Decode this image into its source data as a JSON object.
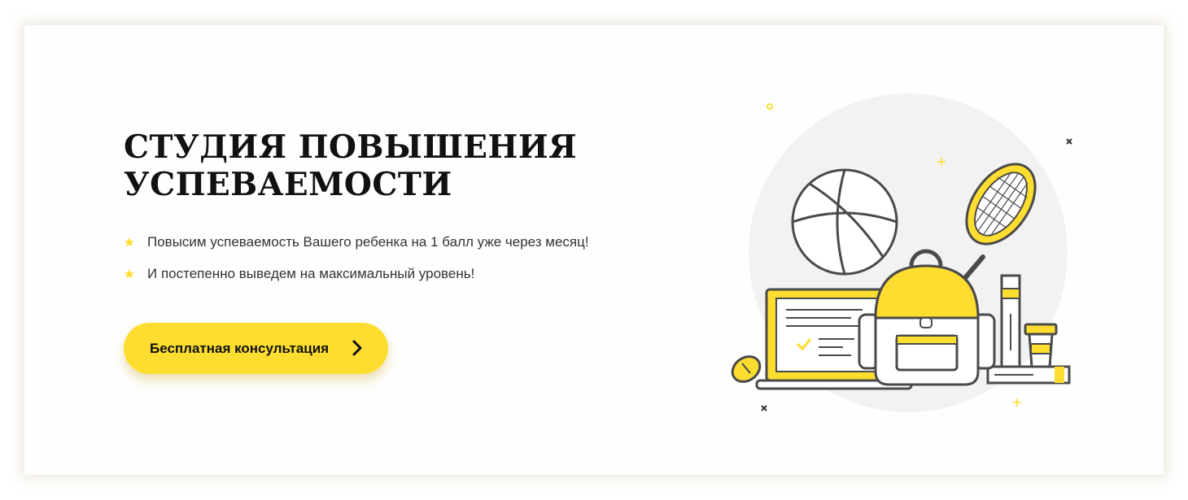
{
  "hero": {
    "title_line1": "СТУДИЯ ПОВЫШЕНИЯ",
    "title_line2": "УСПЕВАЕМОСТИ",
    "bullets": [
      "Повысим успеваемость Вашего ребенка на 1 балл уже через месяц!",
      "И постепенно выведем на максимальный уровень!"
    ],
    "cta_label": "Бесплатная консультация",
    "cta_icon": "chevron-right-icon",
    "bullet_icon": "star-icon"
  },
  "illustration": {
    "icons": [
      "basketball-icon",
      "tennis-racket-icon",
      "laptop-icon",
      "backpack-icon",
      "books-icon",
      "coffee-cup-icon",
      "mouse-icon"
    ]
  },
  "colors": {
    "accent": "#fddd2f",
    "text": "#111111",
    "outline": "#4a4a4a",
    "circle": "#f2f2f2"
  }
}
